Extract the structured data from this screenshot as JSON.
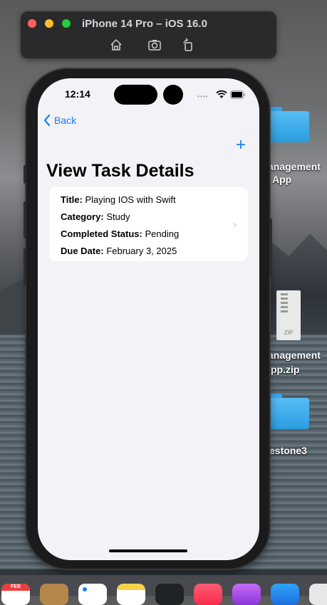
{
  "simulator": {
    "title": "iPhone 14 Pro – iOS 16.0",
    "toolbar": [
      "home-icon",
      "screenshot-icon",
      "rotate-icon"
    ]
  },
  "desktop": {
    "items": [
      {
        "label_line1": "anagement",
        "label_line2": "App",
        "icon": "folder-icon"
      },
      {
        "label_line1": "anagement",
        "label_line2": "pp.zip",
        "icon": "zip-file-icon",
        "badge": "ZIP"
      },
      {
        "label_line1": "estone3",
        "icon": "folder-icon"
      }
    ]
  },
  "status_bar": {
    "time": "12:14"
  },
  "nav": {
    "back_label": "Back",
    "title": "View Task Details",
    "add_icon": "plus-icon"
  },
  "task": {
    "title_label": "Title:",
    "title": "Playing IOS with Swift",
    "category_label": "Category:",
    "category": "Study",
    "status_label": "Completed Status:",
    "status": "Pending",
    "due_label": "Due Date:",
    "due": "February 3, 2025"
  },
  "dock": {
    "calendar_month": "FEB",
    "icons": [
      "calendar-icon",
      "books-icon",
      "reminders-icon",
      "notes-icon",
      "tv-icon",
      "music-icon",
      "podcasts-icon",
      "xcode-icon",
      "chrome-icon"
    ]
  },
  "colors": {
    "accent": "#1a7cf5",
    "background": "#f2f2f7",
    "card": "#ffffff"
  }
}
